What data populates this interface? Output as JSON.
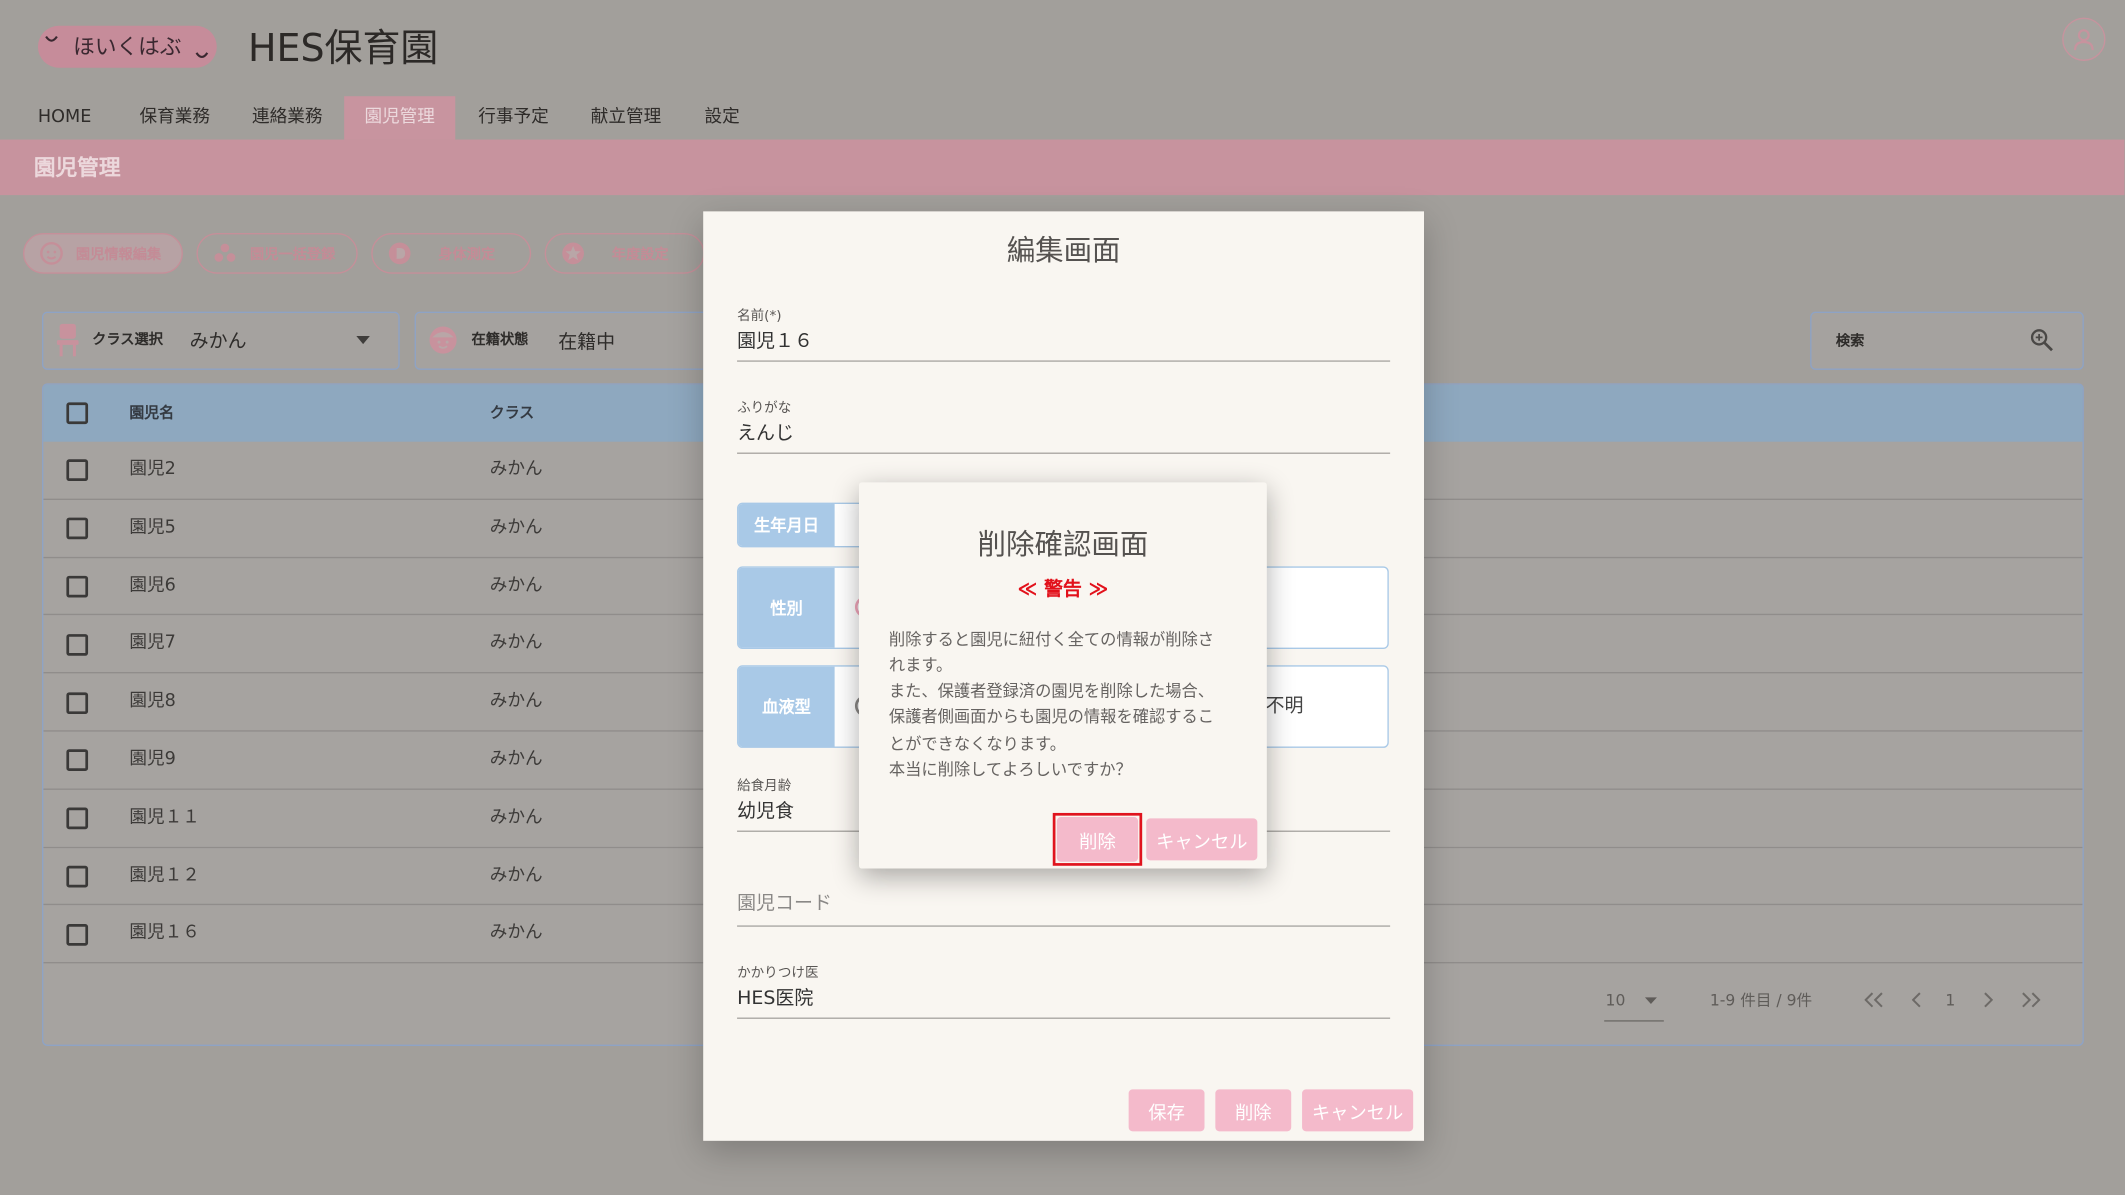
{
  "app": {
    "logo_text": "ほいくはぶ",
    "title": "HES保育園"
  },
  "nav": {
    "items": [
      {
        "label": "HOME"
      },
      {
        "label": "保育業務"
      },
      {
        "label": "連絡業務"
      },
      {
        "label": "園児管理",
        "active": true
      },
      {
        "label": "行事予定"
      },
      {
        "label": "献立管理"
      },
      {
        "label": "設定"
      }
    ]
  },
  "page": {
    "title": "園児管理"
  },
  "actions": [
    {
      "label": "園児情報編集",
      "icon": "child-face-icon",
      "active": true
    },
    {
      "label": "園児一括登録",
      "icon": "group-icon"
    },
    {
      "label": "身体測定",
      "icon": "measure-icon"
    },
    {
      "label": "年度設定",
      "icon": "star-badge-icon"
    }
  ],
  "filters": {
    "class_select": {
      "label": "クラス選択",
      "value": "みかん",
      "icon": "chair-icon"
    },
    "enrollment": {
      "label": "在籍状態",
      "value": "在籍中",
      "icon": "child-icon"
    },
    "search": {
      "label": "検索",
      "icon": "search-icon"
    }
  },
  "table": {
    "columns": {
      "name": "園児名",
      "class": "クラス"
    },
    "rows": [
      {
        "name": "園児2",
        "class": "みかん"
      },
      {
        "name": "園児5",
        "class": "みかん"
      },
      {
        "name": "園児6",
        "class": "みかん"
      },
      {
        "name": "園児7",
        "class": "みかん"
      },
      {
        "name": "園児8",
        "class": "みかん"
      },
      {
        "name": "園児9",
        "class": "みかん"
      },
      {
        "name": "園児１１",
        "class": "みかん"
      },
      {
        "name": "園児１２",
        "class": "みかん"
      },
      {
        "name": "園児１６",
        "class": "みかん"
      }
    ]
  },
  "pagination": {
    "per_page": "10",
    "range": "1-9 件目 / 9件",
    "current_page": "1"
  },
  "edit_dialog": {
    "title": "編集画面",
    "fields": {
      "name": {
        "label": "名前(*)",
        "value": "園児１６"
      },
      "kana": {
        "label": "ふりがな",
        "value": "えんじ"
      },
      "birthdate": {
        "label": "生年月日"
      },
      "gender": {
        "label": "性別"
      },
      "blood_type": {
        "label": "血液型",
        "visible_option": "不明"
      },
      "meal_age": {
        "label": "給食月齢",
        "value": "幼児食"
      },
      "child_code": {
        "placeholder": "園児コード"
      },
      "doctor": {
        "label": "かかりつけ医",
        "value": "HES医院"
      }
    },
    "buttons": {
      "save": "保存",
      "delete": "削除",
      "cancel": "キャンセル"
    }
  },
  "delete_dialog": {
    "title": "削除確認画面",
    "warning": "≪ 警告 ≫",
    "message_lines": [
      "削除すると園児に紐付く全ての情報が削除さ",
      "れます。",
      "また、保護者登録済の園児を削除した場合、",
      "保護者側画面からも園児の情報を確認するこ",
      "とができなくなります。",
      "本当に削除してよろしいですか？"
    ],
    "buttons": {
      "delete": "削除",
      "cancel": "キャンセル"
    }
  },
  "colors": {
    "brand_pink": "#f4bacb",
    "warning_red": "#e2111b",
    "header_blue": "#8ea8bf",
    "label_blue": "#a9c9e7"
  }
}
